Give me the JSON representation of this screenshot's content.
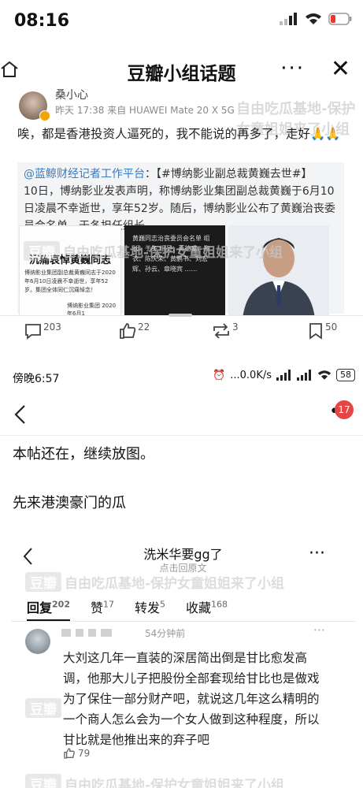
{
  "status_bar": {
    "time": "08:16"
  },
  "nav": {
    "title": "豆瓣小组话题",
    "more": "···"
  },
  "post1": {
    "username": "桑小心",
    "meta": "昨天 17:38 来自 HUAWEI Mate 20 X 5G",
    "text": "唉，都是香港投资人逼死的，我不能说的再多了，走好🙏🙏",
    "quote_link": "@蓝鲸财经记者工作平台",
    "quote_topic": "：【#博纳影业副总裁黄巍去世#】",
    "quote_body": "10日，博纳影业发表声明，称博纳影业集团副总裁黄巍于6月10日凌晨不幸逝世，享年52岁。随后，博纳影业公布了黄巍治丧委员会名单，于冬担任组长。",
    "image1_title": "沉痛哀悼黄巍同志",
    "image1_body": "博纳影业集团副总裁黄巍同志于2020年6月10日凌晨不幸逝世，享年52岁。集团全体同仁沉痛悼念！",
    "image1_footer": "博纳影业集团 2020年6月1",
    "image2_text": "黄巍同志治丧委员会名单 组长：于冬 组员：蒋德富、齐衣、陈庆荣、黄鹏书、刘宏辉、孙云、章晓宾 ……"
  },
  "watermark": {
    "douban": "豆瓣",
    "text": "自由吃瓜基地-保护女童姐姐来了小组"
  },
  "actions": {
    "reply": "203",
    "like": "22",
    "repost": "3",
    "collect": "50"
  },
  "status_bar2": {
    "time": "傍晚6:57",
    "speed": "...0.0K/s",
    "battery": "58"
  },
  "nav2": {
    "dots": "•",
    "notif_count": "17"
  },
  "body": {
    "p1": "本帖还在，继续放图。",
    "p2": "先来港澳豪门的瓜"
  },
  "inner": {
    "title": "洗米华要gg了",
    "subtitle": "点击回原文",
    "tabs": [
      {
        "label": "回复",
        "count": "202"
      },
      {
        "label": "赞",
        "count": "17"
      },
      {
        "label": "转发",
        "count": "5"
      },
      {
        "label": "收藏",
        "count": "168"
      }
    ],
    "comment_time": "54分钟前",
    "comment_text": "大刘这几年一直装的深居简出倒是甘比愈发高调，他那大儿子把股份全部套现给甘比也是做戏为了保住一部分财产吧，就说这几年这么精明的一个商人怎么会为一个女人做到这种程度，所以甘比就是他推出来的弃子吧",
    "comment_likes": "79"
  }
}
